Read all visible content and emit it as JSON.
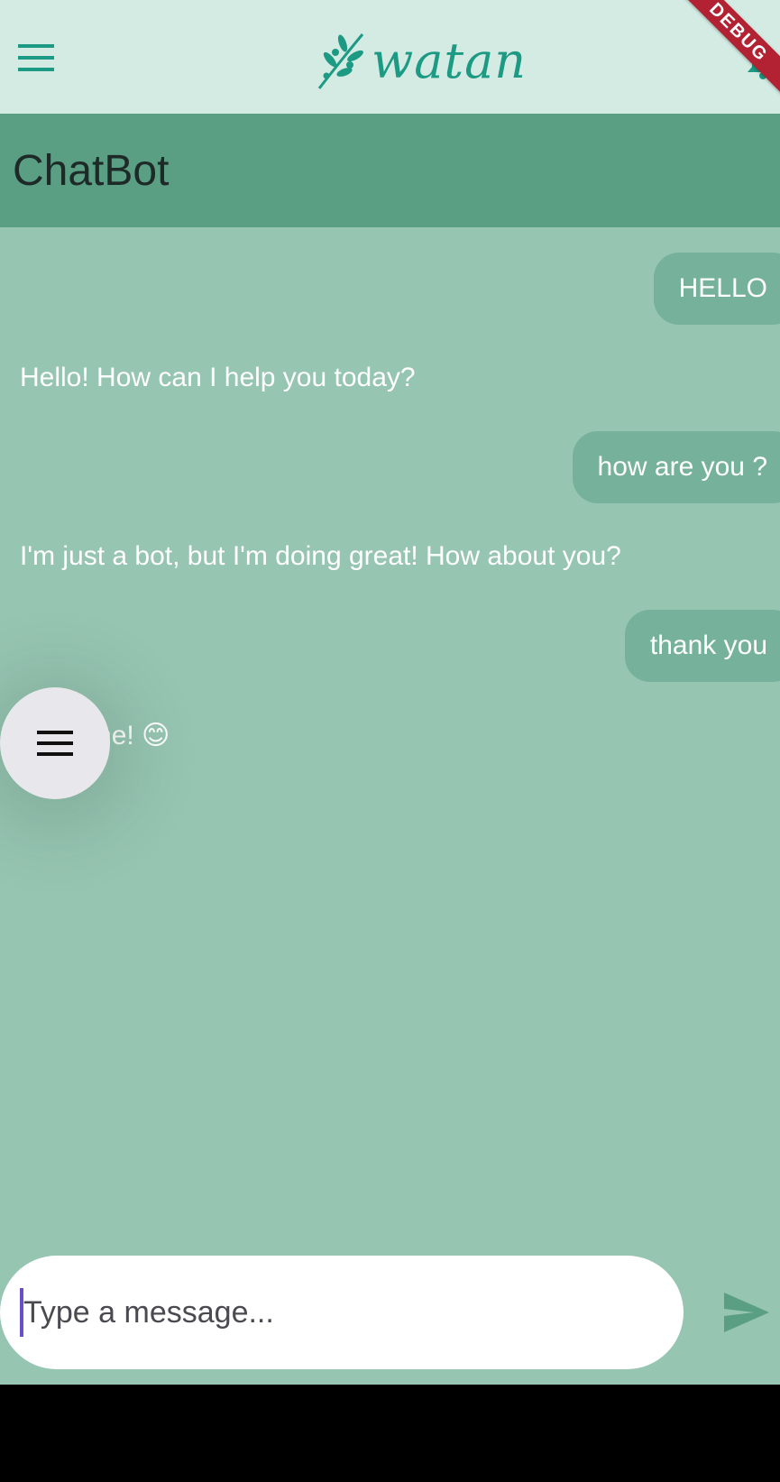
{
  "app": {
    "brand": "watan",
    "debug_banner": "DEBUG"
  },
  "header": {
    "title": "ChatBot"
  },
  "messages": [
    {
      "sender": "user",
      "text": "HELLO"
    },
    {
      "sender": "bot",
      "text": "Hello! How can I help you today?"
    },
    {
      "sender": "user",
      "text": "how are you ?"
    },
    {
      "sender": "bot",
      "text": "I'm just a bot, but I'm doing great! How about you?"
    },
    {
      "sender": "user",
      "text": "thank you"
    },
    {
      "sender": "bot",
      "text": "welcome! 😊"
    }
  ],
  "composer": {
    "placeholder": "Type a message..."
  },
  "icons": {
    "menu": "hamburger-menu-icon",
    "bell": "notification-bell-icon",
    "fab": "hamburger-menu-icon",
    "send": "send-icon",
    "logo": "olive-branch-icon"
  },
  "colors": {
    "topbar": "#d3ebe3",
    "titlebar": "#5a9f84",
    "chat_background": "#96c5b1",
    "user_bubble": "#76b29b",
    "brand_teal": "#1c9a84",
    "send_icon": "#5a9f84"
  }
}
